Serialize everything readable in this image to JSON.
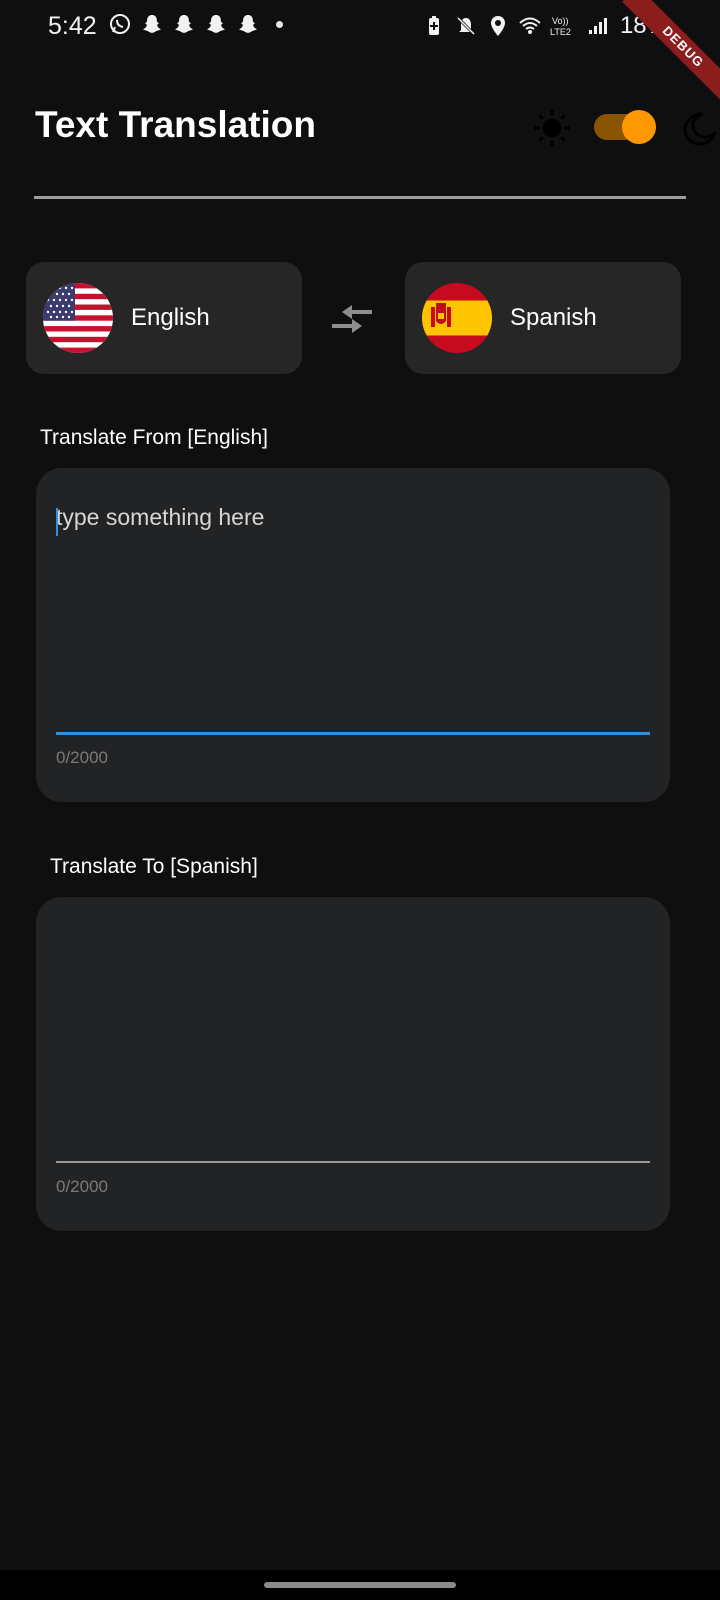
{
  "status_bar": {
    "time": "5:42",
    "battery": "18%",
    "notification_icons": [
      "whatsapp-icon",
      "snapchat-icon",
      "snapchat-icon",
      "snapchat-icon",
      "snapchat-icon"
    ],
    "system_icons": [
      "battery-saver-icon",
      "mute-icon",
      "location-icon",
      "wifi-icon",
      "volte-icon",
      "signal-icon"
    ],
    "volte_label": "Vo)) LTE2"
  },
  "debug_banner": "DEBUG",
  "header": {
    "title": "Text Translation",
    "theme_toggle_on": true
  },
  "languages": {
    "source": "English",
    "target": "Spanish"
  },
  "input": {
    "label": "Translate From [English]",
    "placeholder": "type something here",
    "value": "",
    "counter": "0/2000"
  },
  "output": {
    "label": "Translate To [Spanish]",
    "value": "",
    "counter": "0/2000"
  },
  "colors": {
    "background": "#0f0f0f",
    "card": "#262626",
    "text_box": "#222325",
    "accent": "#2f8fe0",
    "toggle": "#ff9800"
  }
}
